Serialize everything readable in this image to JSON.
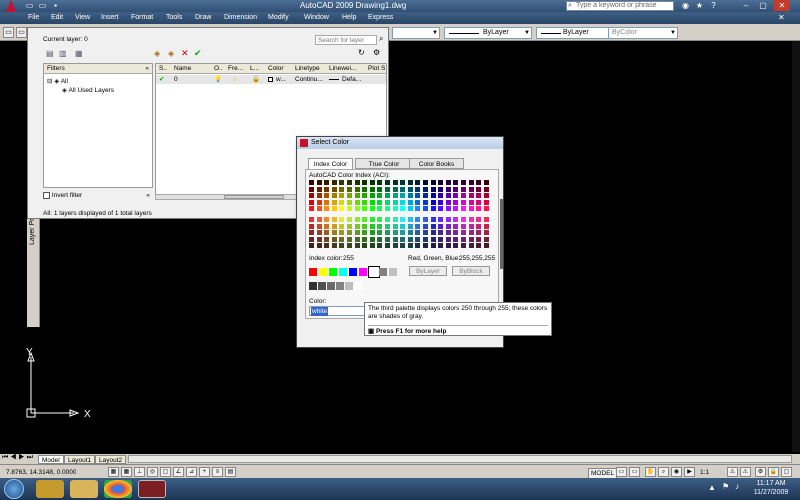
{
  "app": {
    "title": "AutoCAD 2009  Drawing1.dwg",
    "search_placeholder": "Type a keyword or phrase",
    "menus": [
      "File",
      "Edit",
      "View",
      "Insert",
      "Format",
      "Tools",
      "Draw",
      "Dimension",
      "Modify",
      "Window",
      "Help",
      "Express"
    ]
  },
  "toolbar": {
    "linetype1": "ByLayer",
    "linetype2": "ByLayer",
    "color": "ByColor"
  },
  "layer_manager": {
    "current_layer": "Current layer: 0",
    "search_placeholder": "Search for layer",
    "filters_header": "Filters",
    "tree_all": "All",
    "tree_used": "All Used Layers",
    "invert_filter": "Invert filter",
    "columns": [
      "S..",
      "Name",
      "O..",
      "Fre...",
      "L...",
      "Color",
      "Linetype",
      "Linewei...",
      "Plot S"
    ],
    "rows": [
      {
        "status": "✔",
        "name": "0",
        "color": "w...",
        "linetype": "Continu...",
        "lineweight": "Defa..."
      }
    ],
    "status_text": "All: 1 layers displayed of 1 total layers",
    "side_label": "Layer Properties Manager"
  },
  "dialog": {
    "title": "Select Color",
    "tabs": [
      "Index Color",
      "True Color",
      "Color Books"
    ],
    "aci_label": "AutoCAD Color Index (ACI):",
    "index_color_label": "Index color:",
    "index_color_value": "255",
    "rgb_label": "Red, Green, Blue:",
    "rgb_value": "255,255,255",
    "bylayer": "ByLayer",
    "byblock": "ByBlock",
    "color_label": "Color:",
    "color_value": "white"
  },
  "tooltip": {
    "text": "The third palette displays colors 250 through 255; these colors are shades of gray.",
    "help": "Press F1 for more help"
  },
  "ucs": {
    "x": "X",
    "y": "Y"
  },
  "layout_tabs": [
    "Model",
    "Layout1",
    "Layout2"
  ],
  "status": {
    "coords": "7.8763, 14.3148, 0.0000",
    "model": "MODEL",
    "scale": "1:1"
  },
  "clock": {
    "time": "11:17 AM",
    "date": "11/27/2009"
  },
  "palette": {
    "standard": [
      "#ff0000",
      "#ffff00",
      "#00ff00",
      "#00ffff",
      "#0000ff",
      "#ff00ff",
      "#ffffff",
      "#808080",
      "#c0c0c0"
    ],
    "grays": [
      "#333333",
      "#505050",
      "#696969",
      "#828282",
      "#bebebe",
      "#ffffff"
    ]
  }
}
